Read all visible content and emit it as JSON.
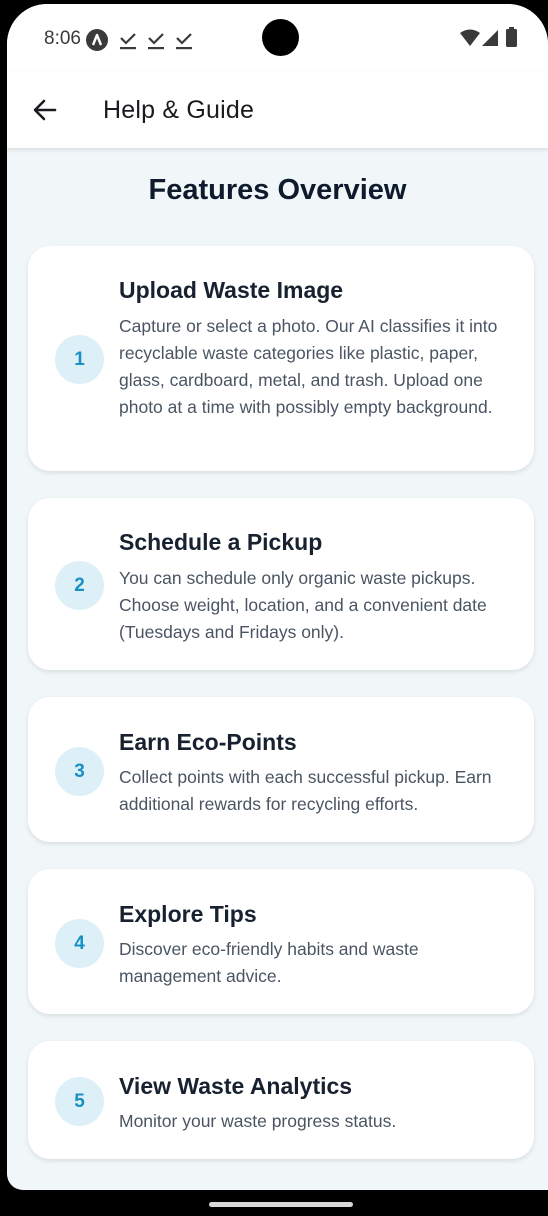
{
  "status_bar": {
    "time": "8:06",
    "icons": [
      "a-badge-icon",
      "download-check-icon",
      "download-check-icon",
      "download-check-icon",
      "wifi-icon",
      "cellular-signal-icon",
      "battery-icon"
    ]
  },
  "app_bar": {
    "back_icon": "arrow-left-icon",
    "title": "Help & Guide"
  },
  "main": {
    "section_title": "Features Overview",
    "features": [
      {
        "number": "1",
        "title": "Upload Waste Image",
        "description": "Capture or select a photo. Our AI classifies it into recyclable waste categories like plastic, paper, glass, cardboard, metal, and trash. Upload one photo at a time with possibly empty background."
      },
      {
        "number": "2",
        "title": "Schedule a Pickup",
        "description": "You can schedule only organic waste pickups. Choose weight, location, and a convenient date (Tuesdays and Fridays only)."
      },
      {
        "number": "3",
        "title": "Earn Eco-Points",
        "description": "Collect points with each successful pickup. Earn additional rewards for recycling efforts."
      },
      {
        "number": "4",
        "title": "Explore Tips",
        "description": "Discover eco-friendly habits and waste management advice."
      },
      {
        "number": "5",
        "title": "View Waste Analytics",
        "description": "Monitor your waste progress status."
      }
    ]
  },
  "colors": {
    "background": "#F1F7F9",
    "card": "#FFFFFF",
    "badge_bg": "#DDF0F8",
    "badge_text": "#1A8FC4",
    "title_text": "#0F1B2D",
    "body_text": "#4A5563"
  }
}
